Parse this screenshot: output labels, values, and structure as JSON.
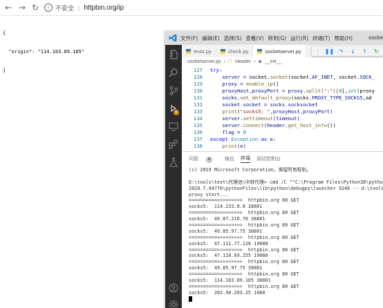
{
  "browser": {
    "insecure_label": "不安全",
    "url": "httpbin.org/ip",
    "json_lines": [
      "{",
      "  \"origin\": \"114.103.89.105\"",
      "}"
    ]
  },
  "vscode": {
    "menu": [
      "文件(F)",
      "编辑(E)",
      "选择(S)",
      "查看(V)",
      "转到(G)",
      "运行(R)",
      "终端(T)",
      "帮助(H)"
    ],
    "window_title": "socke",
    "tabs": [
      {
        "label": "tests.py"
      },
      {
        "label": "check.py"
      },
      {
        "label": "socketserver.py"
      }
    ],
    "breadcrumb": {
      "file": "socketserver.py",
      "sep1": "›",
      "class": "Header",
      "sep2": "›",
      "method": "__init__"
    },
    "debug_badge": "5",
    "panel_tabs": {
      "problems": "问题",
      "problems_count": "4",
      "output": "输出",
      "terminal": "终端",
      "debug_console": "调试控制台"
    },
    "code_lines": [
      {
        "ln": "127",
        "segments": [
          {
            "t": "try:",
            "c": "kw"
          }
        ]
      },
      {
        "ln": "128",
        "segments": [
          {
            "t": "    server = ",
            "c": "var"
          },
          {
            "t": "socket",
            "c": ""
          },
          {
            "t": ".",
            "c": ""
          },
          {
            "t": "socket",
            "c": "fn"
          },
          {
            "t": "(socket.",
            "c": ""
          },
          {
            "t": "AF_INET",
            "c": "var"
          },
          {
            "t": ", socket.",
            "c": ""
          },
          {
            "t": "SOCK_",
            "c": "var"
          }
        ]
      },
      {
        "ln": "129",
        "segments": [
          {
            "t": "    proxy = ",
            "c": "var"
          },
          {
            "t": "enable_ip",
            "c": "fn"
          },
          {
            "t": "()",
            "c": ""
          }
        ]
      },
      {
        "ln": "130",
        "segments": [
          {
            "t": "    proxyHost,proxyPort = proxy.",
            "c": "var"
          },
          {
            "t": "split",
            "c": "fn"
          },
          {
            "t": "(\":\")[",
            "c": "str"
          },
          {
            "t": "0",
            "c": "num"
          },
          {
            "t": "],",
            "c": ""
          },
          {
            "t": "int",
            "c": "cls"
          },
          {
            "t": "(proxy",
            "c": ""
          }
        ]
      },
      {
        "ln": "131",
        "segments": [
          {
            "t": "    socks.",
            "c": "var"
          },
          {
            "t": "set_default_proxy",
            "c": "fn"
          },
          {
            "t": "(socks.",
            "c": ""
          },
          {
            "t": "PROXY_TYPE_SOCKS5",
            "c": "var"
          },
          {
            "t": ",ad",
            "c": ""
          }
        ]
      },
      {
        "ln": "132",
        "segments": [
          {
            "t": "    socket.socket = socks.socksocket",
            "c": "var"
          }
        ]
      },
      {
        "ln": "133",
        "segments": [
          {
            "t": "    ",
            "c": ""
          },
          {
            "t": "print",
            "c": "fn"
          },
          {
            "t": "(",
            "c": ""
          },
          {
            "t": "\"socks5: \"",
            "c": "str"
          },
          {
            "t": ",proxyHost,proxyPort)",
            "c": "var"
          }
        ]
      },
      {
        "ln": "134",
        "segments": [
          {
            "t": "    server.",
            "c": "var"
          },
          {
            "t": "settimeout",
            "c": "fn"
          },
          {
            "t": "(timeout)",
            "c": "var"
          }
        ]
      },
      {
        "ln": "135",
        "segments": [
          {
            "t": "    server.",
            "c": "var"
          },
          {
            "t": "connect",
            "c": "fn"
          },
          {
            "t": "(header.",
            "c": "var"
          },
          {
            "t": "get_host_info",
            "c": "fn"
          },
          {
            "t": "())",
            "c": ""
          }
        ]
      },
      {
        "ln": "136",
        "segments": [
          {
            "t": "    flag = ",
            "c": "var"
          },
          {
            "t": "0",
            "c": "num"
          }
        ]
      },
      {
        "ln": "137",
        "segments": [
          {
            "t": "except ",
            "c": "kw"
          },
          {
            "t": "Exception",
            "c": "cls"
          },
          {
            "t": " as ",
            "c": "kw"
          },
          {
            "t": "e:",
            "c": "var"
          }
        ]
      },
      {
        "ln": "138",
        "segments": [
          {
            "t": "    ",
            "c": ""
          },
          {
            "t": "print",
            "c": "fn"
          },
          {
            "t": "(e)",
            "c": "var"
          }
        ]
      }
    ],
    "terminal_lines": [
      "(c) 2019 Microsoft Corporation。保留所有权利。",
      "",
      "D:\\tools\\test\\代理池\\中转代理> cmd /C \"\"C:\\Program Files\\Python38\\python.exe",
      "2020.7.94776\\pythonFiles\\lib\\python\\debugpy\\launcher 9246 -- d:\\tools\\test\\",
      "proxy start...",
      "==========>>>>>>>>>  httpbin.org 80 GET",
      "socks5:  114.233.8.8 38801",
      "==========>>>>>>>>>  httpbin.org 80 GET",
      "socks5:  49.87.210.70 38801",
      "==========>>>>>>>>>  httpbin.org 80 GET",
      "socks5:  49.85.97.75 38801",
      "==========>>>>>>>>>  httpbin.org 80 GET",
      "socks5:  47.111.77.126 19080",
      "==========>>>>>>>>>  httpbin.org 80 GET",
      "socks5:  47.110.69.255 19080",
      "==========>>>>>>>>>  httpbin.org 80 GET",
      "socks5:  49.85.97.75 38801",
      "==========>>>>>>>>>  httpbin.org 80 GET",
      "socks5:  114.103.89.105 38801",
      "==========>>>>>>>>>  httpbin.org 80 GET",
      "socks5:  202.98.203.25 1080"
    ]
  }
}
